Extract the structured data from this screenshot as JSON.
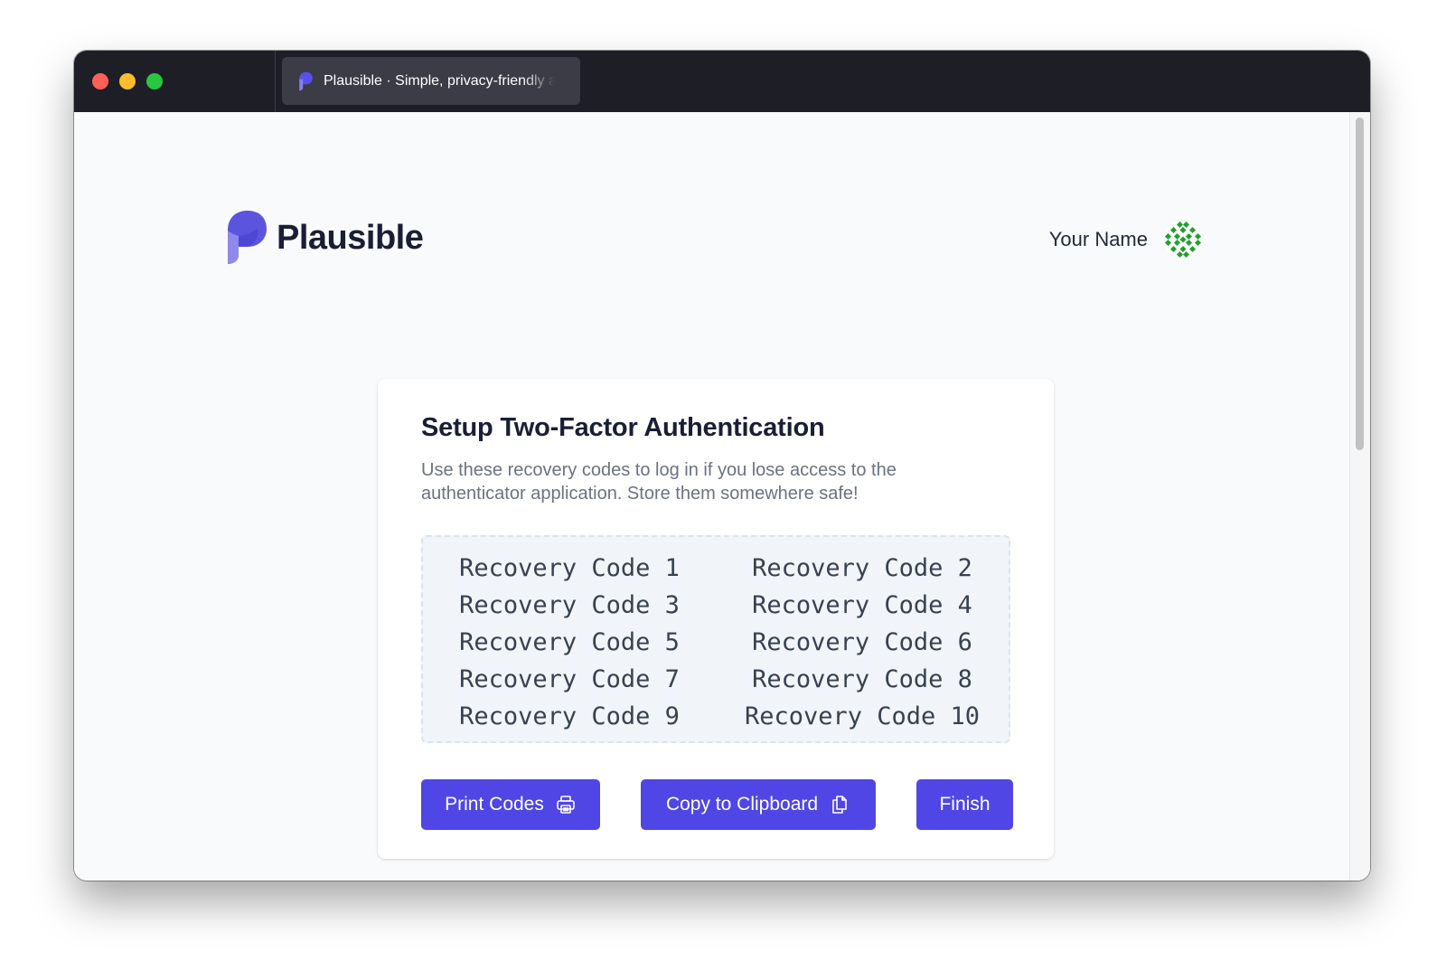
{
  "browser": {
    "tab_title": "Plausible · Simple, privacy-friendly alternative to Google Analytics"
  },
  "header": {
    "logo_text": "Plausible",
    "user_name": "Your Name"
  },
  "card": {
    "title": "Setup Two-Factor Authentication",
    "description": "Use these recovery codes to log in if you lose access to the authenticator application. Store them somewhere safe!",
    "codes": [
      "Recovery Code 1",
      "Recovery Code 2",
      "Recovery Code 3",
      "Recovery Code 4",
      "Recovery Code 5",
      "Recovery Code 6",
      "Recovery Code 7",
      "Recovery Code 8",
      "Recovery Code 9",
      "Recovery Code 10"
    ],
    "buttons": {
      "print_label": "Print Codes",
      "copy_label": "Copy to Clipboard",
      "finish_label": "Finish"
    }
  },
  "icons": {
    "print": "printer-icon",
    "copy": "copy-icon",
    "logo": "plausible-logo-icon",
    "avatar": "gravatar-identicon"
  },
  "colors": {
    "primary": "#4f46e5",
    "titlebar": "#1e1f26",
    "page_bg": "#f9fafb",
    "avatar_green": "#22a02f"
  }
}
